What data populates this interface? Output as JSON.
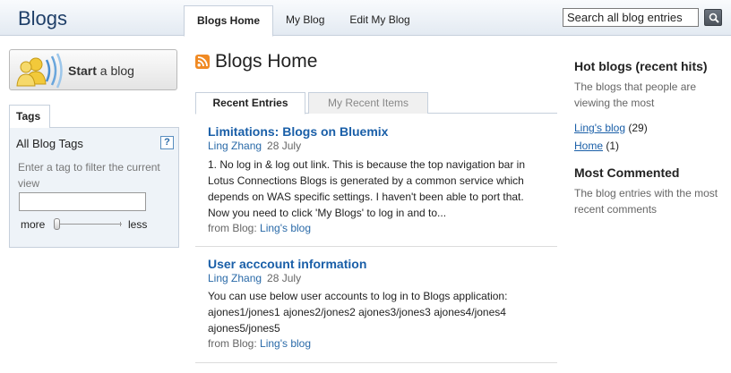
{
  "app": {
    "title": "Blogs"
  },
  "nav": {
    "tabs": [
      {
        "label": "Blogs Home",
        "active": true
      },
      {
        "label": "My Blog",
        "active": false
      },
      {
        "label": "Edit My Blog",
        "active": false
      }
    ]
  },
  "search": {
    "value": "Search all blog entries",
    "button_icon": "magnifier-icon"
  },
  "start_button": {
    "strong": "Start",
    "rest": " a blog",
    "icon": "people-broadcast-icon"
  },
  "tags": {
    "tab_label": "Tags",
    "heading": "All Blog Tags",
    "help_icon": "?",
    "hint": "Enter a tag to filter the current view",
    "filter_value": "",
    "slider_min_label": "more",
    "slider_max_label": "less",
    "slider_position": 0
  },
  "main": {
    "feed_icon": "rss-feed-icon",
    "title": "Blogs Home",
    "tabs": [
      {
        "label": "Recent Entries",
        "active": true
      },
      {
        "label": "My Recent Items",
        "active": false
      }
    ],
    "entries": [
      {
        "title": "Limitations: Blogs on Bluemix",
        "author": "Ling Zhang",
        "date": "28 July",
        "excerpt": "1. No log in & log out link. This is because the top navigation bar in Lotus Connections Blogs is generated by a common service which depends on WAS specific settings. I haven't been able to port that. Now you need to click 'My Blogs' to log in and to...",
        "from_label": "from Blog:",
        "blog": "Ling's blog"
      },
      {
        "title": "User acccount information",
        "author": "Ling Zhang",
        "date": "28 July",
        "excerpt": "You can use below user accounts to log in to Blogs application: ajones1/jones1 ajones2/jones2 ajones3/jones3 ajones4/jones4 ajones5/jones5",
        "from_label": "from Blog:",
        "blog": "Ling's blog"
      }
    ]
  },
  "sidebar": {
    "hot": {
      "heading": "Hot blogs (recent hits)",
      "description": "The blogs that people are viewing the most",
      "items": [
        {
          "name": "Ling's blog",
          "count": "(29)"
        },
        {
          "name": "Home",
          "count": "(1)"
        }
      ]
    },
    "commented": {
      "heading": "Most Commented",
      "description": "The blog entries with the most recent comments"
    }
  },
  "colors": {
    "link": "#1a5fa8",
    "banner_top": "#f9fbfd",
    "banner_bottom": "#e3eaf2",
    "panel_bg": "#eef3f8",
    "border": "#c6d0dc"
  }
}
